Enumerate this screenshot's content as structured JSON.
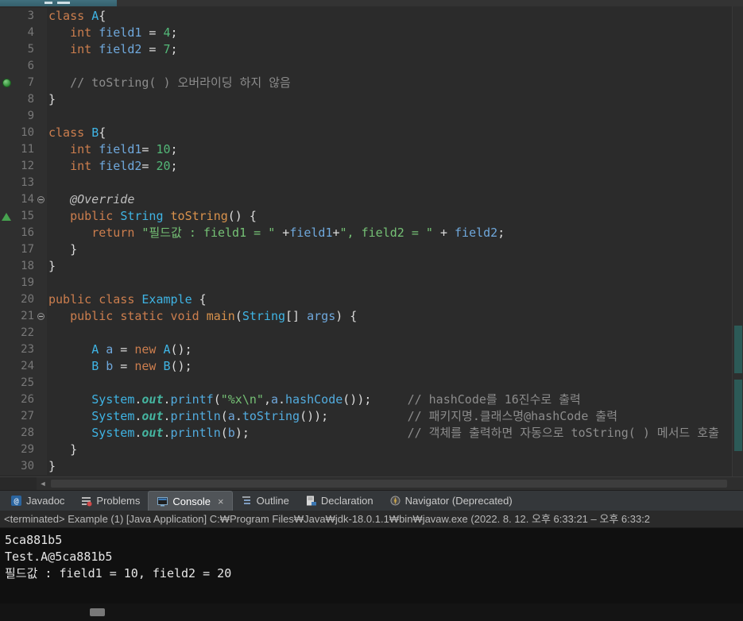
{
  "palette": {
    "editor_bg": "#2B2B2B",
    "console_bg": "#101010",
    "keyword": "#CC7E4E",
    "type": "#3FB4E4",
    "field": "#6FA8DC",
    "number": "#53B878",
    "string": "#75C175",
    "comment": "#8C8C8C",
    "annotation": "#BFBFBF",
    "method": "#D9924C",
    "invocation": "#52ACDF",
    "static_field": "#45B5A0",
    "plain": "#DCDCDC",
    "line_number": "#787878"
  },
  "editor": {
    "lines": [
      {
        "n": 3,
        "tokens": [
          [
            "kw",
            "class"
          ],
          [
            "pln",
            " "
          ],
          [
            "ty",
            "A"
          ],
          [
            "pln",
            "{"
          ]
        ]
      },
      {
        "n": 4,
        "tokens": [
          [
            "pln",
            "   "
          ],
          [
            "kw",
            "int"
          ],
          [
            "pln",
            " "
          ],
          [
            "fld",
            "field1"
          ],
          [
            "pln",
            " = "
          ],
          [
            "num",
            "4"
          ],
          [
            "pln",
            ";"
          ]
        ]
      },
      {
        "n": 5,
        "tokens": [
          [
            "pln",
            "   "
          ],
          [
            "kw",
            "int"
          ],
          [
            "pln",
            " "
          ],
          [
            "fld",
            "field2"
          ],
          [
            "pln",
            " = "
          ],
          [
            "num",
            "7"
          ],
          [
            "pln",
            ";"
          ]
        ]
      },
      {
        "n": 6,
        "tokens": []
      },
      {
        "n": 7,
        "marker": "breakpoint",
        "tokens": [
          [
            "pln",
            "   "
          ],
          [
            "cm",
            "// toString( ) 오버라이딩 하지 않음"
          ]
        ]
      },
      {
        "n": 8,
        "tokens": [
          [
            "pln",
            "}"
          ]
        ]
      },
      {
        "n": 9,
        "tokens": []
      },
      {
        "n": 10,
        "tokens": [
          [
            "kw",
            "class"
          ],
          [
            "pln",
            " "
          ],
          [
            "ty",
            "B"
          ],
          [
            "pln",
            "{"
          ]
        ]
      },
      {
        "n": 11,
        "tokens": [
          [
            "pln",
            "   "
          ],
          [
            "kw",
            "int"
          ],
          [
            "pln",
            " "
          ],
          [
            "fld",
            "field1"
          ],
          [
            "pln",
            "= "
          ],
          [
            "num",
            "10"
          ],
          [
            "pln",
            ";"
          ]
        ]
      },
      {
        "n": 12,
        "tokens": [
          [
            "pln",
            "   "
          ],
          [
            "kw",
            "int"
          ],
          [
            "pln",
            " "
          ],
          [
            "fld",
            "field2"
          ],
          [
            "pln",
            "= "
          ],
          [
            "num",
            "20"
          ],
          [
            "pln",
            ";"
          ]
        ]
      },
      {
        "n": 13,
        "tokens": []
      },
      {
        "n": 14,
        "fold": true,
        "tokens": [
          [
            "pln",
            "   "
          ],
          [
            "ann",
            "@Override"
          ]
        ]
      },
      {
        "n": 15,
        "marker": "override",
        "tokens": [
          [
            "pln",
            "   "
          ],
          [
            "kw",
            "public"
          ],
          [
            "pln",
            " "
          ],
          [
            "ty",
            "String"
          ],
          [
            "pln",
            " "
          ],
          [
            "mth",
            "toString"
          ],
          [
            "pln",
            "() {"
          ]
        ]
      },
      {
        "n": 16,
        "tokens": [
          [
            "pln",
            "      "
          ],
          [
            "kw",
            "return"
          ],
          [
            "pln",
            " "
          ],
          [
            "str",
            "\"필드값 : field1 = \""
          ],
          [
            "pln",
            " +"
          ],
          [
            "fld",
            "field1"
          ],
          [
            "pln",
            "+"
          ],
          [
            "str",
            "\", field2 = \""
          ],
          [
            "pln",
            " + "
          ],
          [
            "fld",
            "field2"
          ],
          [
            "pln",
            ";"
          ]
        ]
      },
      {
        "n": 17,
        "tokens": [
          [
            "pln",
            "   }"
          ]
        ]
      },
      {
        "n": 18,
        "tokens": [
          [
            "pln",
            "}"
          ]
        ]
      },
      {
        "n": 19,
        "tokens": []
      },
      {
        "n": 20,
        "tokens": [
          [
            "kw",
            "public"
          ],
          [
            "pln",
            " "
          ],
          [
            "kw",
            "class"
          ],
          [
            "pln",
            " "
          ],
          [
            "ty",
            "Example"
          ],
          [
            "pln",
            " {"
          ]
        ]
      },
      {
        "n": 21,
        "fold": true,
        "tokens": [
          [
            "pln",
            "   "
          ],
          [
            "kw",
            "public"
          ],
          [
            "pln",
            " "
          ],
          [
            "kw",
            "static"
          ],
          [
            "pln",
            " "
          ],
          [
            "kw",
            "void"
          ],
          [
            "pln",
            " "
          ],
          [
            "mth",
            "main"
          ],
          [
            "pln",
            "("
          ],
          [
            "ty",
            "String"
          ],
          [
            "pln",
            "[] "
          ],
          [
            "fld",
            "args"
          ],
          [
            "pln",
            ") {"
          ]
        ]
      },
      {
        "n": 22,
        "tokens": []
      },
      {
        "n": 23,
        "tokens": [
          [
            "pln",
            "      "
          ],
          [
            "ty",
            "A"
          ],
          [
            "pln",
            " "
          ],
          [
            "fld",
            "a"
          ],
          [
            "pln",
            " = "
          ],
          [
            "kw",
            "new"
          ],
          [
            "pln",
            " "
          ],
          [
            "ty",
            "A"
          ],
          [
            "pln",
            "();"
          ]
        ]
      },
      {
        "n": 24,
        "tokens": [
          [
            "pln",
            "      "
          ],
          [
            "ty",
            "B"
          ],
          [
            "pln",
            " "
          ],
          [
            "fld",
            "b"
          ],
          [
            "pln",
            " = "
          ],
          [
            "kw",
            "new"
          ],
          [
            "pln",
            " "
          ],
          [
            "ty",
            "B"
          ],
          [
            "pln",
            "();"
          ]
        ]
      },
      {
        "n": 25,
        "tokens": []
      },
      {
        "n": 26,
        "tokens": [
          [
            "pln",
            "      "
          ],
          [
            "ty",
            "System"
          ],
          [
            "pln",
            "."
          ],
          [
            "stf",
            "out"
          ],
          [
            "pln",
            "."
          ],
          [
            "inv",
            "printf"
          ],
          [
            "pln",
            "("
          ],
          [
            "str",
            "\"%x\\n\""
          ],
          [
            "pln",
            ","
          ],
          [
            "fld",
            "a"
          ],
          [
            "pln",
            "."
          ],
          [
            "inv",
            "hashCode"
          ],
          [
            "pln",
            "());     "
          ],
          [
            "cm",
            "// hashCode를 16진수로 출력"
          ]
        ]
      },
      {
        "n": 27,
        "tokens": [
          [
            "pln",
            "      "
          ],
          [
            "ty",
            "System"
          ],
          [
            "pln",
            "."
          ],
          [
            "stf",
            "out"
          ],
          [
            "pln",
            "."
          ],
          [
            "inv",
            "println"
          ],
          [
            "pln",
            "("
          ],
          [
            "fld",
            "a"
          ],
          [
            "pln",
            "."
          ],
          [
            "inv",
            "toString"
          ],
          [
            "pln",
            "());           "
          ],
          [
            "cm",
            "// 패키지명.클래스명@hashCode 출력"
          ]
        ]
      },
      {
        "n": 28,
        "tokens": [
          [
            "pln",
            "      "
          ],
          [
            "ty",
            "System"
          ],
          [
            "pln",
            "."
          ],
          [
            "stf",
            "out"
          ],
          [
            "pln",
            "."
          ],
          [
            "inv",
            "println"
          ],
          [
            "pln",
            "("
          ],
          [
            "fld",
            "b"
          ],
          [
            "pln",
            ");                      "
          ],
          [
            "cm",
            "// 객체를 출력하면 자동으로 toString( ) 메서드 호출"
          ]
        ]
      },
      {
        "n": 29,
        "tokens": [
          [
            "pln",
            "   }"
          ]
        ]
      },
      {
        "n": 30,
        "tokens": [
          [
            "pln",
            "}"
          ]
        ]
      }
    ]
  },
  "editor_scrollbar": {
    "left_arrow": "◄"
  },
  "console_tabs": {
    "tabs": [
      {
        "label": "Javadoc",
        "icon": "javadoc-icon",
        "active": false
      },
      {
        "label": "Problems",
        "icon": "problems-icon",
        "active": false
      },
      {
        "label": "Console",
        "icon": "console-icon",
        "active": true,
        "close": "×"
      },
      {
        "label": "Outline",
        "icon": "outline-icon",
        "active": false
      },
      {
        "label": "Declaration",
        "icon": "declaration-icon",
        "active": false
      },
      {
        "label": "Navigator (Deprecated)",
        "icon": "navigator-icon",
        "active": false
      }
    ]
  },
  "console": {
    "status_line": "<terminated> Example (1) [Java Application] C:₩Program Files₩Java₩jdk-18.0.1.1₩bin₩javaw.exe  (2022. 8. 12. 오후 6:33:21 – 오후 6:33:2",
    "output_lines": [
      "5ca881b5",
      "Test.A@5ca881b5",
      "필드값 : field1 = 10, field2 = 20"
    ]
  }
}
